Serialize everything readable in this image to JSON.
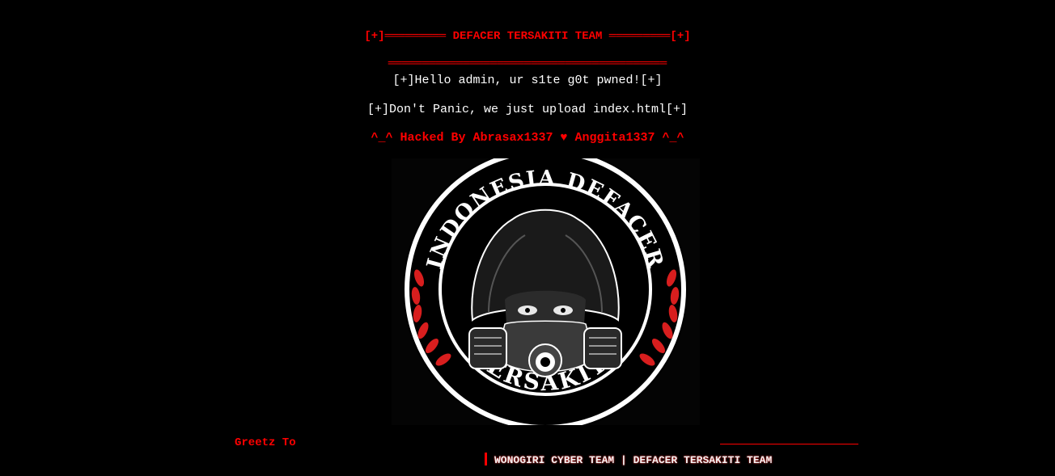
{
  "header": {
    "title": "[+]═════════ DEFACER TERSAKITI TEAM ═════════[+]",
    "divider": "═════════════════════════════════════════"
  },
  "message": {
    "hello": "[+]Hello admin, ur s1te g0t pwned![+]",
    "panic": "[+]Don't Panic, we just upload index.html[+]",
    "hacked_by": "^_^ Hacked By Abrasax1337 ♥ Anggita1337 ^_^"
  },
  "logo": {
    "top_text": "INDONESIA DEFACER",
    "bottom_text": "TERSAKITI"
  },
  "greetz": {
    "label": "Greetz To",
    "marquee": "WONOGIRI CYBER TEAM | DEFACER TERSAKITI TEAM"
  },
  "colors": {
    "background": "#000000",
    "accent": "#ff0000",
    "text": "#ffffff"
  }
}
